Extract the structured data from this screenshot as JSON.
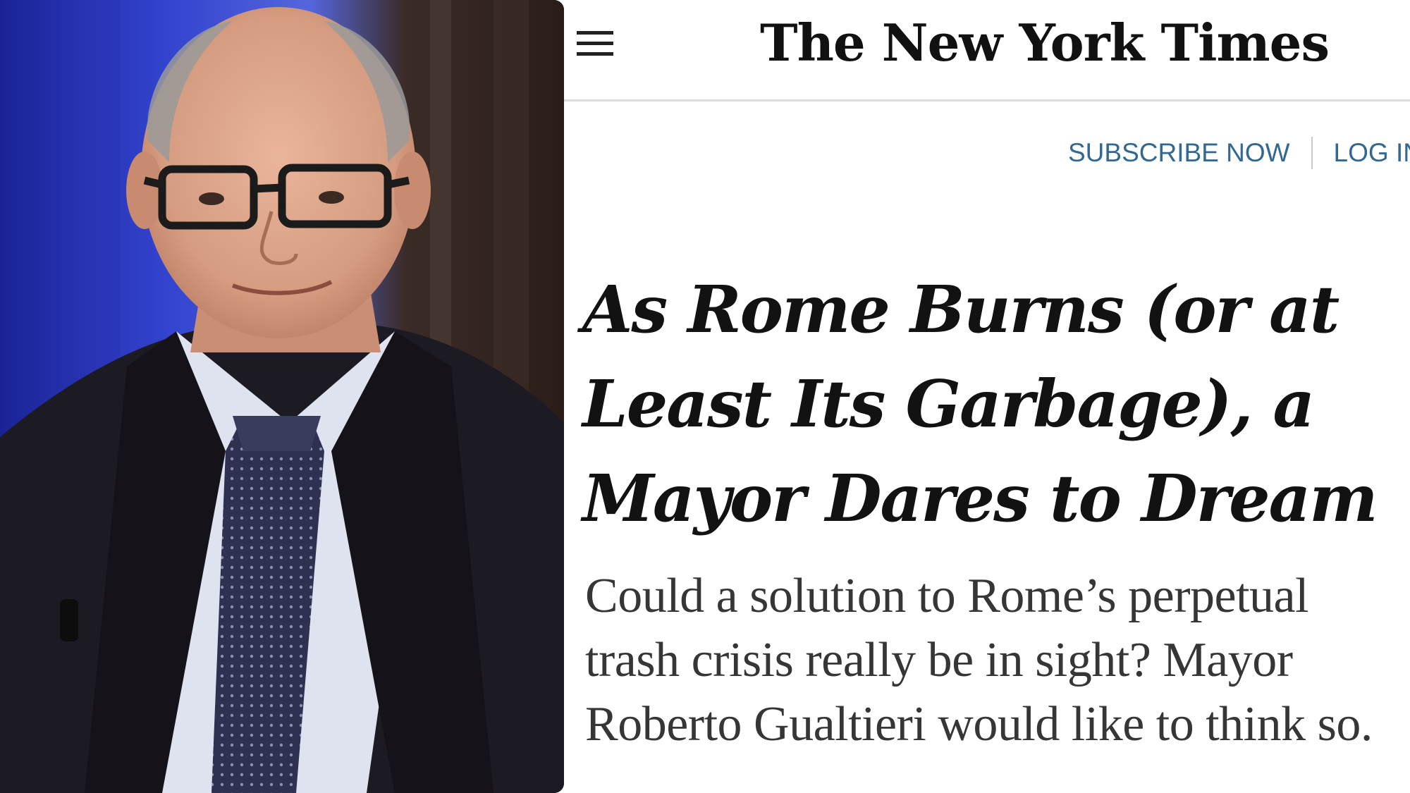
{
  "colors": {
    "link": "#326891",
    "headline": "#121212",
    "summary": "#363636",
    "rule": "#dcdcdc"
  },
  "icons": {
    "menu": "hamburger-menu-icon"
  },
  "masthead": {
    "title": "The New York Times"
  },
  "account": {
    "subscribe_label": "SUBSCRIBE NOW",
    "login_label": "LOG IN"
  },
  "article": {
    "headline": "As Rome Burns (or at Least Its Garbage), a Mayor Dares to Dream",
    "summary": "Could a solution to Rome’s perpetual trash crisis really be in sight? Mayor Roberto Gualtieri would like to think so."
  }
}
